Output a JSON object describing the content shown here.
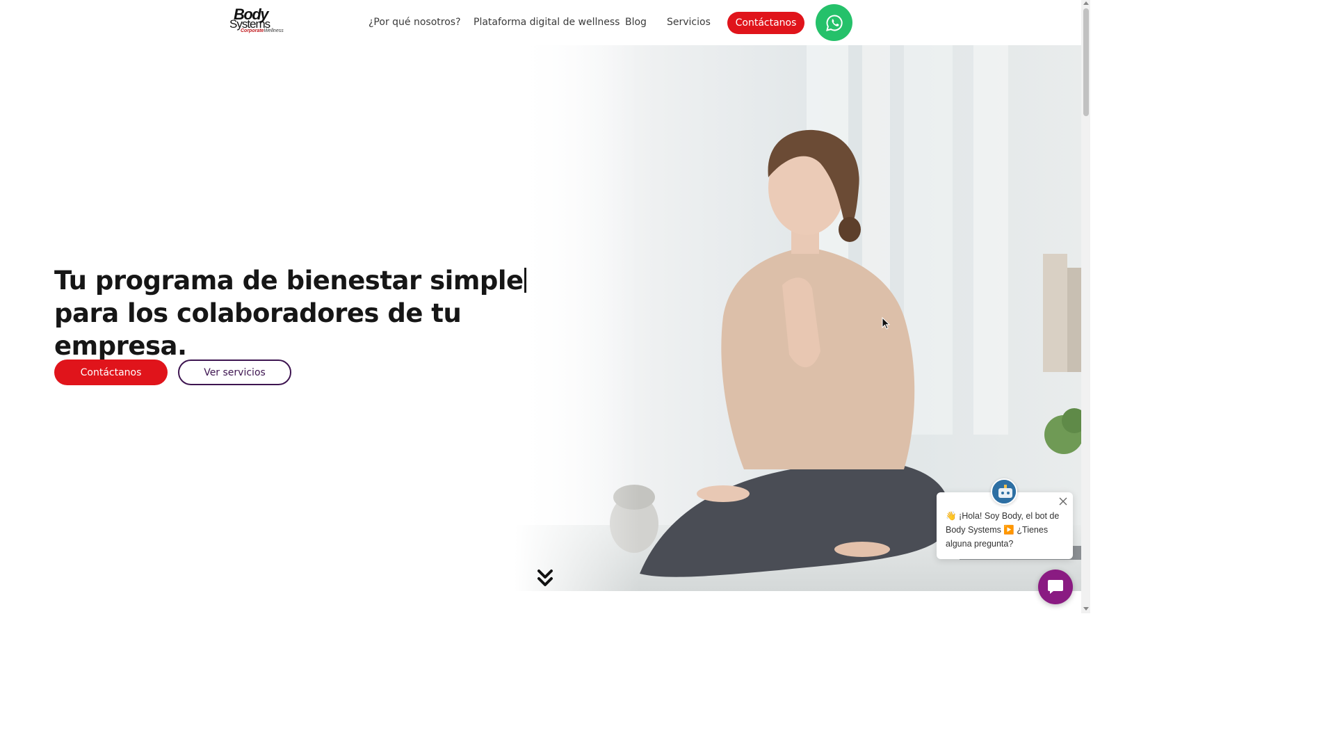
{
  "header": {
    "logo": {
      "line1": "Body",
      "line2": "Systems",
      "line3a": "Corporate",
      "line3b": "Wellness"
    },
    "nav": [
      {
        "label": "¿Por qué nosotros?"
      },
      {
        "label": "Plataforma digital de wellness"
      },
      {
        "label": "Blog"
      },
      {
        "label": "Servicios"
      }
    ],
    "contact_label": "Contáctanos",
    "whatsapp_icon": "whatsapp-icon"
  },
  "hero": {
    "headline_part1": "Tu programa de bienestar simple",
    "headline_part2": " para los colaboradores de tu empresa.",
    "contact_label": "Contáctanos",
    "services_label": "Ver servicios",
    "scroll_icon": "double-chevron-down-icon"
  },
  "chat": {
    "message": "👋 ¡Hola! Soy Body, el bot de Body Systems ▶️ ¿Tienes alguna pregunta?",
    "avatar_icon": "bot-avatar-icon",
    "close_icon": "close-icon",
    "launcher_icon": "chat-icon"
  },
  "colors": {
    "brand_red": "#e0141b",
    "brand_purple": "#3d1450",
    "whatsapp_green": "#25c16a",
    "chat_purple": "#8a1b82"
  }
}
